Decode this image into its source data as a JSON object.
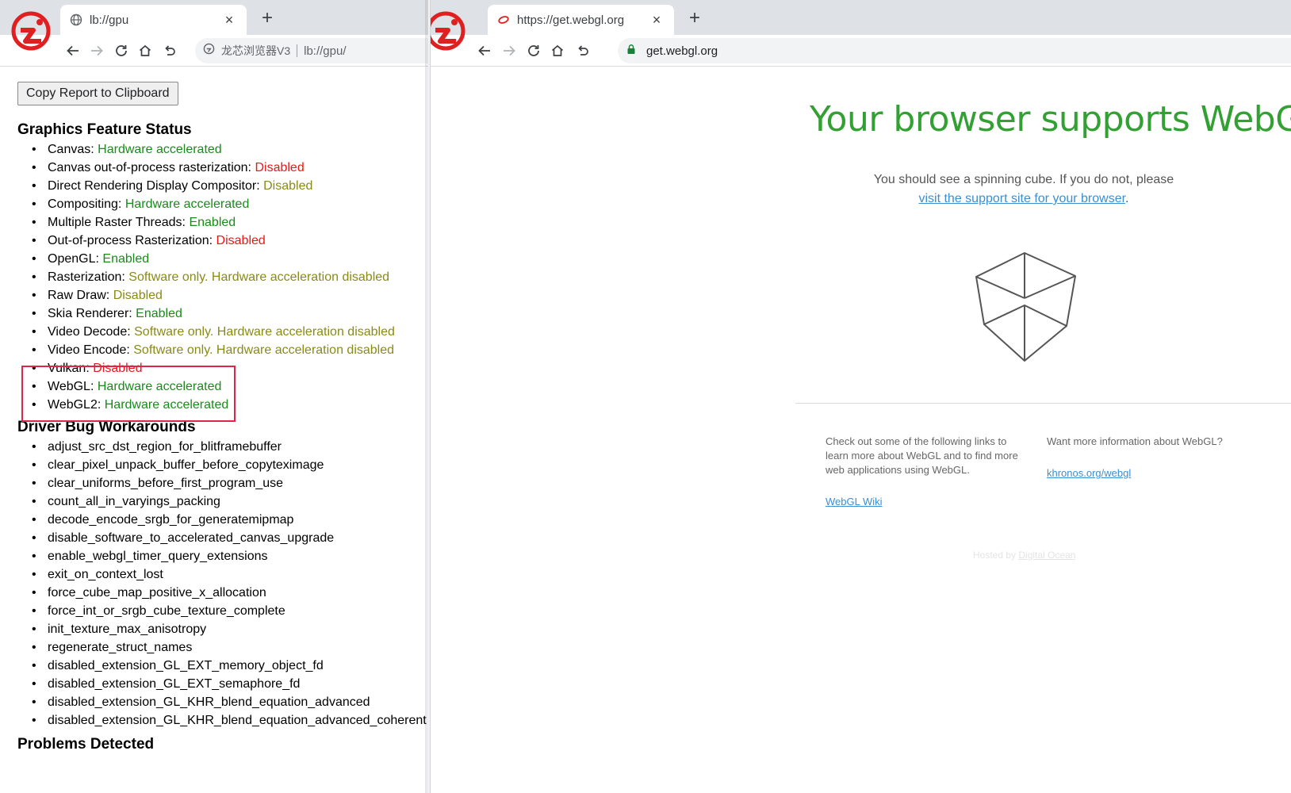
{
  "left_window": {
    "tab": {
      "title": "lb://gpu",
      "close": "×"
    },
    "new_tab": "+",
    "omnibox": {
      "site_name": "龙芯浏览器V3",
      "url": "lb://gpu/"
    },
    "copy_button": "Copy Report to Clipboard",
    "feature_section_title": "Graphics Feature Status",
    "features": [
      {
        "name": "Canvas:",
        "status": "Hardware accelerated",
        "color": "#1a8a1a"
      },
      {
        "name": "Canvas out-of-process rasterization:",
        "status": "Disabled",
        "color": "#e81818"
      },
      {
        "name": "Direct Rendering Display Compositor:",
        "status": "Disabled",
        "color": "#8a8a16"
      },
      {
        "name": "Compositing:",
        "status": "Hardware accelerated",
        "color": "#1a8a1a"
      },
      {
        "name": "Multiple Raster Threads:",
        "status": "Enabled",
        "color": "#1a8a1a"
      },
      {
        "name": "Out-of-process Rasterization:",
        "status": "Disabled",
        "color": "#e81818"
      },
      {
        "name": "OpenGL:",
        "status": "Enabled",
        "color": "#1a8a1a"
      },
      {
        "name": "Rasterization:",
        "status": "Software only. Hardware acceleration disabled",
        "color": "#8a8a16"
      },
      {
        "name": "Raw Draw:",
        "status": "Disabled",
        "color": "#8a8a16"
      },
      {
        "name": "Skia Renderer:",
        "status": "Enabled",
        "color": "#1a8a1a"
      },
      {
        "name": "Video Decode:",
        "status": "Software only. Hardware acceleration disabled",
        "color": "#8a8a16"
      },
      {
        "name": "Video Encode:",
        "status": "Software only. Hardware acceleration disabled",
        "color": "#8a8a16"
      },
      {
        "name": "Vulkan:",
        "status": "Disabled",
        "color": "#e81818"
      },
      {
        "name": "WebGL:",
        "status": "Hardware accelerated",
        "color": "#1a8a1a"
      },
      {
        "name": "WebGL2:",
        "status": "Hardware accelerated",
        "color": "#1a8a1a"
      }
    ],
    "workarounds_title": "Driver Bug Workarounds",
    "workarounds": [
      "adjust_src_dst_region_for_blitframebuffer",
      "clear_pixel_unpack_buffer_before_copyteximage",
      "clear_uniforms_before_first_program_use",
      "count_all_in_varyings_packing",
      "decode_encode_srgb_for_generatemipmap",
      "disable_software_to_accelerated_canvas_upgrade",
      "enable_webgl_timer_query_extensions",
      "exit_on_context_lost",
      "force_cube_map_positive_x_allocation",
      "force_int_or_srgb_cube_texture_complete",
      "init_texture_max_anisotropy",
      "regenerate_struct_names",
      "disabled_extension_GL_EXT_memory_object_fd",
      "disabled_extension_GL_EXT_semaphore_fd",
      "disabled_extension_GL_KHR_blend_equation_advanced",
      "disabled_extension_GL_KHR_blend_equation_advanced_coherent"
    ],
    "problems_title": "Problems Detected"
  },
  "right_window": {
    "tab": {
      "title": "https://get.webgl.org",
      "close": "×"
    },
    "new_tab": "+",
    "omnibox": {
      "url": "get.webgl.org"
    },
    "headline": "Your browser supports WebGL",
    "message": "You should see a spinning cube. If you do not, please",
    "support_link": "visit the support site for your browser",
    "message_end": ".",
    "col1_text": "Check out some of the following links to learn more about WebGL and to find more web applications using WebGL.",
    "col1_link": "WebGL Wiki",
    "col2_text": "Want more information about WebGL?",
    "col2_link": "khronos.org/webgl",
    "hosted_prefix": "Hosted by",
    "hosted_link": "Digital Ocean"
  },
  "colors": {
    "accent_green": "#33a033",
    "link_blue": "#3b8fd0",
    "highlight_red": "#e0254a",
    "logo_red": "#e02020"
  }
}
